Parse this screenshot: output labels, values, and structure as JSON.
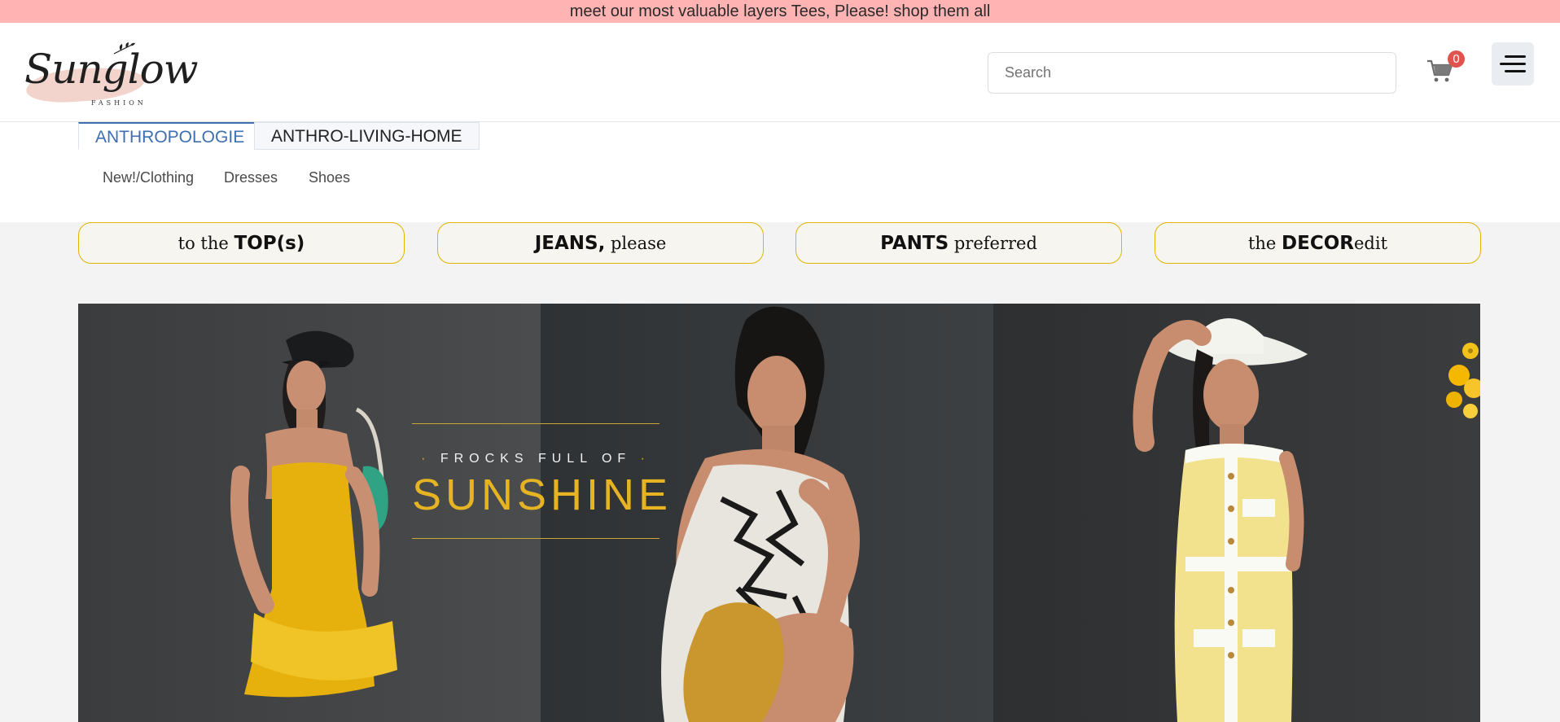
{
  "promo": {
    "text": "meet our most valuable layers Tees, Please! shop them all"
  },
  "brand": {
    "name": "Sunglow",
    "tagline": "FASHION"
  },
  "search": {
    "placeholder": "Search"
  },
  "cart": {
    "count": "0",
    "icon": "cart-icon",
    "badge_color": "#e2524f"
  },
  "menu": {
    "icon": "hamburger-menu-icon"
  },
  "tabs": [
    {
      "label": "ANTHROPOLOGIE",
      "active": true
    },
    {
      "label": "ANTHRO-LIVING-HOME",
      "active": false
    }
  ],
  "subcategories": [
    "New!/Clothing",
    "Dresses",
    "Shoes"
  ],
  "pills": [
    {
      "pre": "to the ",
      "bold": "TOP(s)",
      "post": ""
    },
    {
      "pre": "",
      "bold": "JEANS,",
      "post": " please"
    },
    {
      "pre": "",
      "bold": "PANTS",
      "post": " preferred"
    },
    {
      "pre": "the ",
      "bold": "DECOR",
      "post": "edit"
    }
  ],
  "hero": {
    "kicker": "FROCKS FULL OF",
    "title": "SUNSHINE"
  },
  "colors": {
    "promo_bg": "#ffb3b3",
    "accent_blue": "#3f6fb0",
    "pill_border": "#e0b400",
    "hero_gold": "#e6b422"
  }
}
